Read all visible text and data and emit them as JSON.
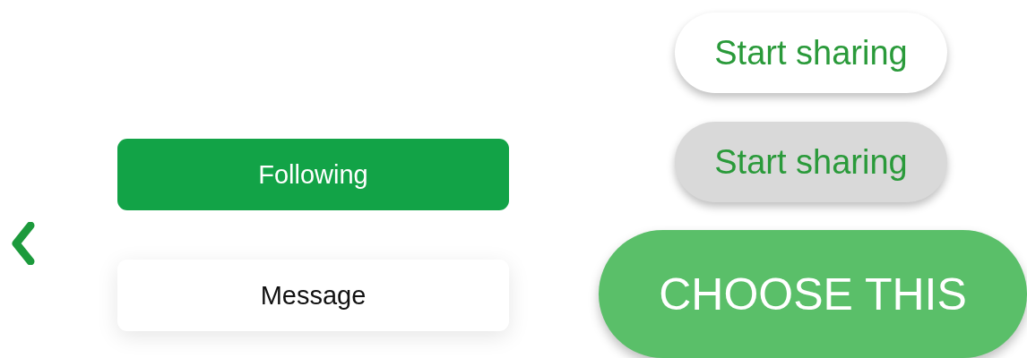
{
  "profile_buttons": [
    {
      "label": "Following",
      "kind": "primary"
    },
    {
      "label": "Message",
      "kind": "secondary"
    }
  ],
  "share_buttons": [
    {
      "label": "Start sharing",
      "pressed": false
    },
    {
      "label": "Start sharing",
      "pressed": true
    }
  ],
  "cta": {
    "label": "CHOOSE THIS"
  }
}
